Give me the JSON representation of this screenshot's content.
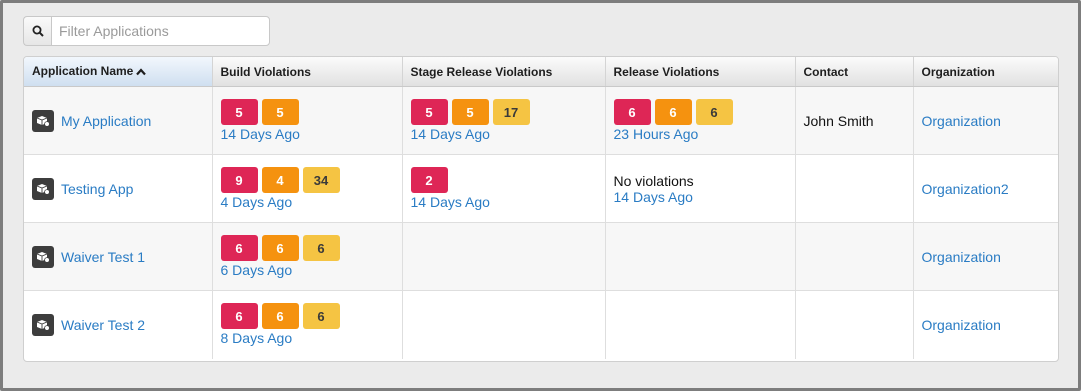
{
  "filter": {
    "placeholder": "Filter Applications"
  },
  "table": {
    "headers": {
      "application_name": "Application Name",
      "build_violations": "Build Violations",
      "stage_release_violations": "Stage Release Violations",
      "release_violations": "Release Violations",
      "contact": "Contact",
      "organization": "Organization"
    },
    "rows": [
      {
        "name": "My Application",
        "build": {
          "badges": [
            "5",
            "5"
          ],
          "time": "14 Days Ago"
        },
        "stage": {
          "badges": [
            "5",
            "5",
            "17"
          ],
          "time": "14 Days Ago"
        },
        "release": {
          "badges": [
            "6",
            "6",
            "6"
          ],
          "time": "23 Hours Ago"
        },
        "contact": "John Smith",
        "organization": "Organization"
      },
      {
        "name": "Testing App",
        "build": {
          "badges": [
            "9",
            "4",
            "34"
          ],
          "time": "4 Days Ago"
        },
        "stage": {
          "badges": [
            "2"
          ],
          "time": "14 Days Ago"
        },
        "release": {
          "text": "No violations",
          "time": "14 Days Ago"
        },
        "contact": "",
        "organization": "Organization2"
      },
      {
        "name": "Waiver Test 1",
        "build": {
          "badges": [
            "6",
            "6",
            "6"
          ],
          "time": "6 Days Ago"
        },
        "organization": "Organization"
      },
      {
        "name": "Waiver Test 2",
        "build": {
          "badges": [
            "6",
            "6",
            "6"
          ],
          "time": "8 Days Ago"
        },
        "organization": "Organization"
      }
    ]
  },
  "icons": {
    "filter": "search-icon",
    "sort": "chevron-up-icon",
    "app": "application-icon"
  },
  "colors": {
    "critical": "#de2656",
    "severe": "#f5920f",
    "moderate": "#f5c443",
    "link": "#2a7cc4"
  }
}
